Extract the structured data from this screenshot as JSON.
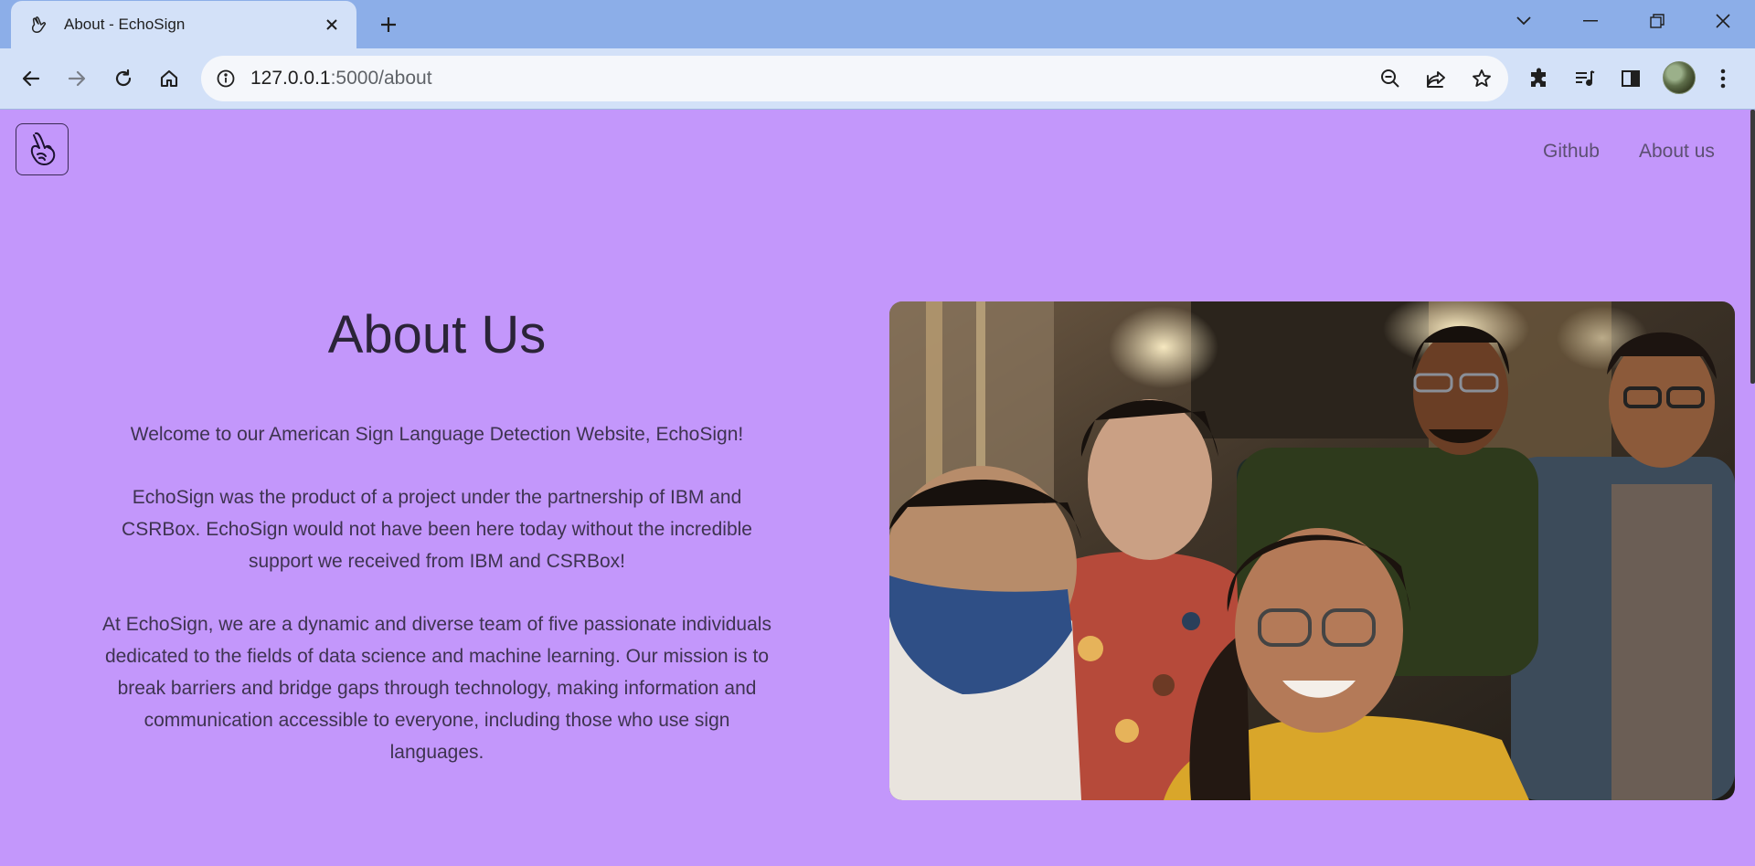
{
  "browser": {
    "tab_title": "About - EchoSign",
    "url_host": "127.0.0.1",
    "url_rest": ":5000/about",
    "icons": {
      "back": "arrow-left-icon",
      "forward": "arrow-right-icon",
      "reload": "reload-icon",
      "home": "home-icon",
      "site_info": "info-icon",
      "zoom": "zoom-out-icon",
      "share": "share-icon",
      "bookmark": "star-icon",
      "extensions": "puzzle-icon",
      "media": "media-queue-icon",
      "side_panel": "side-panel-icon",
      "menu": "kebab-menu-icon"
    }
  },
  "nav": {
    "github": "Github",
    "about": "About us"
  },
  "about": {
    "heading": "About Us",
    "p1": "Welcome to our American Sign Language Detection Website, EchoSign!",
    "p2": "EchoSign was the product of a project under the partnership of IBM and CSRBox. EchoSign would not have been here today without the incredible support we received from IBM and CSRBox!",
    "p3": "At EchoSign, we are a dynamic and diverse team of five passionate individuals dedicated to the fields of data science and machine learning. Our mission is to break barriers and bridge gaps through technology, making information and communication accessible to everyone, including those who use sign languages."
  },
  "colors": {
    "page_bg": "#c397fb",
    "tab_strip": "#8caee8",
    "toolbar": "#d3e1f8",
    "heading": "#2b2438",
    "body_text": "#3e3350"
  }
}
